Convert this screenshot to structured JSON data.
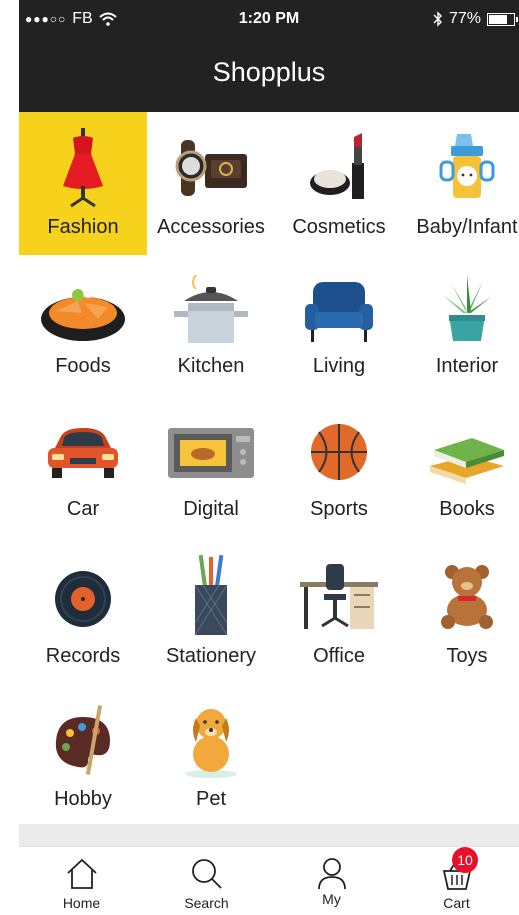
{
  "status_bar": {
    "carrier": "FB",
    "time": "1:20 PM",
    "battery": "77%",
    "battery_level": 0.77
  },
  "header": {
    "title": "Shopplus"
  },
  "categories": [
    {
      "label": "Fashion",
      "icon": "dress-icon",
      "selected": true
    },
    {
      "label": "Accessories",
      "icon": "watch-icon"
    },
    {
      "label": "Cosmetics",
      "icon": "lipstick-icon"
    },
    {
      "label": "Baby/Infant",
      "icon": "sippy-cup-icon"
    },
    {
      "label": "Foods",
      "icon": "food-plate-icon"
    },
    {
      "label": "Kitchen",
      "icon": "pot-icon"
    },
    {
      "label": "Living",
      "icon": "sofa-icon"
    },
    {
      "label": "Interior",
      "icon": "plant-icon"
    },
    {
      "label": "Car",
      "icon": "car-icon"
    },
    {
      "label": "Digital",
      "icon": "microwave-icon"
    },
    {
      "label": "Sports",
      "icon": "basketball-icon"
    },
    {
      "label": "Books",
      "icon": "books-icon"
    },
    {
      "label": "Records",
      "icon": "vinyl-record-icon"
    },
    {
      "label": "Stationery",
      "icon": "pencil-cup-icon"
    },
    {
      "label": "Office",
      "icon": "office-desk-icon"
    },
    {
      "label": "Toys",
      "icon": "teddy-bear-icon"
    },
    {
      "label": "Hobby",
      "icon": "paint-palette-icon"
    },
    {
      "label": "Pet",
      "icon": "dog-icon"
    }
  ],
  "bottom_nav": {
    "home": "Home",
    "search": "Search",
    "my": "My",
    "cart": "Cart",
    "cart_count": "10"
  },
  "colors": {
    "header_bg": "#222222",
    "selected_bg": "#f6d21c",
    "badge": "#e8112d"
  }
}
